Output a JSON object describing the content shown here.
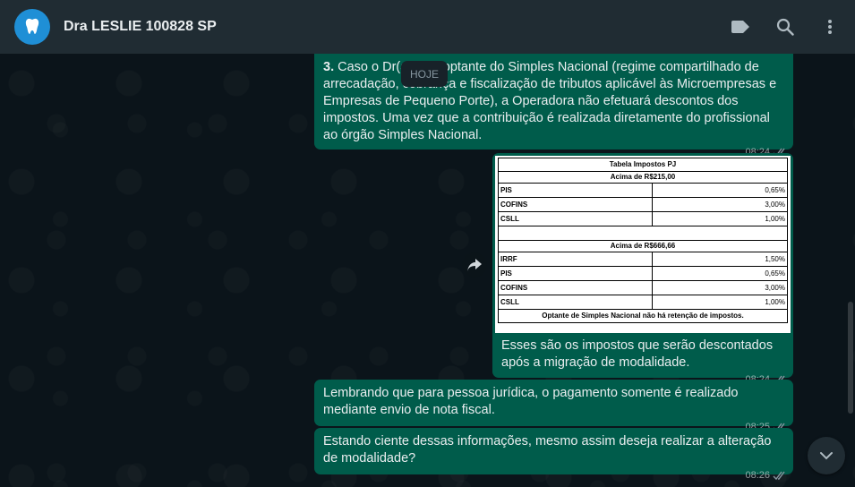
{
  "header": {
    "contact_name": "Dra LESLIE 100828 SP",
    "avatar_icon": "dental-clinic-logo",
    "icons": [
      "label-icon",
      "search-icon",
      "menu-dots-icon"
    ]
  },
  "date_separator": "HOJE",
  "messages": [
    {
      "number": "3.",
      "text": " Caso o Dr(a) seja optante do Simples Nacional (regime compartilhado de arrecadação, cobrança e fiscalização de tributos aplicável às Microempresas e Empresas de Pequeno Porte), a Operadora não efetuará descontos dos impostos. Uma vez que a contribuição é realizada diretamente do profissional ao órgão Simples Nacional.",
      "time": "08:24"
    },
    {
      "image_table": {
        "title": "Tabela Impostos PJ",
        "section1_header": "Acima de R$215,00",
        "section1_rows": [
          {
            "name": "PIS",
            "value": "0,65%"
          },
          {
            "name": "COFINS",
            "value": "3,00%"
          },
          {
            "name": "CSLL",
            "value": "1,00%"
          }
        ],
        "section2_header": "Acima de R$666,66",
        "section2_rows": [
          {
            "name": "IRRF",
            "value": "1,50%"
          },
          {
            "name": "PIS",
            "value": "0,65%"
          },
          {
            "name": "COFINS",
            "value": "3,00%"
          },
          {
            "name": "CSLL",
            "value": "1,00%"
          }
        ],
        "footer": "Optante de Simples Nacional não há retenção de impostos."
      },
      "caption": "Esses são os impostos que serão descontados após a migração de modalidade.",
      "time": "08:24"
    },
    {
      "text": "Lembrando que para pessoa jurídica, o pagamento somente é realizado mediante envio de nota fiscal.",
      "time": "08:25"
    },
    {
      "text": "Estando ciente dessas informações, mesmo assim deseja realizar a alteração de modalidade?",
      "time": "08:26"
    }
  ],
  "colors": {
    "outgoing_bubble": "#005c4b",
    "header": "#202c33",
    "chat_bg": "#0b141a",
    "read_ticks": "#8696a0"
  }
}
